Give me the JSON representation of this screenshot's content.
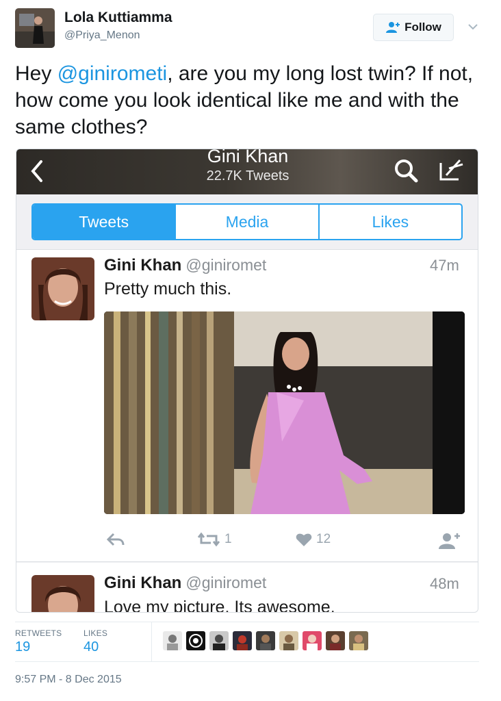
{
  "author": {
    "name": "Lola Kuttiamma",
    "handle": "@Priya_Menon"
  },
  "follow_label": "Follow",
  "tweet": {
    "prefix": "Hey ",
    "mention": "@ginirometi",
    "suffix": ", are you my long lost twin? If not, how come you look identical like me and with the same clothes?"
  },
  "embedded": {
    "profile_name": "Gini Khan",
    "profile_tweets": "22.7K Tweets",
    "tabs": [
      "Tweets",
      "Media",
      "Likes"
    ],
    "active_tab": "Tweets",
    "tweet1": {
      "name": "Gini Khan",
      "handle": "@giniromet",
      "time": "47m",
      "text": "Pretty much this.",
      "retweets": "1",
      "likes": "12"
    },
    "tweet2": {
      "name": "Gini Khan",
      "handle": "@giniromet",
      "time": "48m",
      "text": "Love my picture. Its awesome."
    }
  },
  "stats": {
    "retweets_label": "RETWEETS",
    "retweets": "19",
    "likes_label": "LIKES",
    "likes": "40"
  },
  "timestamp": "9:57 PM - 8 Dec 2015",
  "colors": {
    "link": "#1b95e0",
    "tab_accent": "#2aa3ef",
    "muted": "#657786"
  }
}
